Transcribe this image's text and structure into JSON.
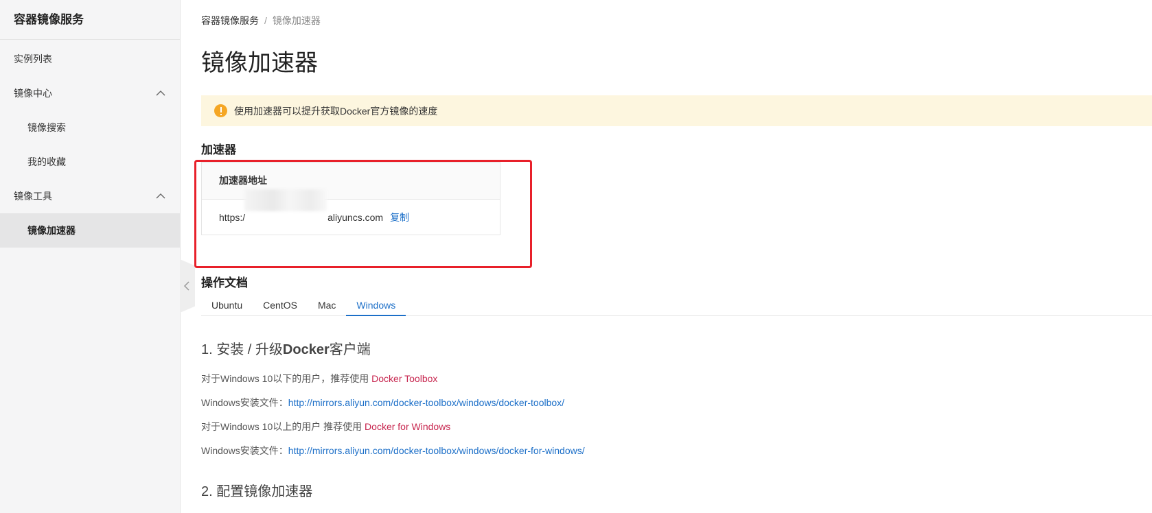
{
  "sidebar": {
    "title": "容器镜像服务",
    "items": [
      {
        "label": "实例列表"
      },
      {
        "label": "镜像中心"
      },
      {
        "label": "镜像搜索"
      },
      {
        "label": "我的收藏"
      },
      {
        "label": "镜像工具"
      },
      {
        "label": "镜像加速器"
      }
    ]
  },
  "breadcrumb": {
    "root": "容器镜像服务",
    "separator": "/",
    "current": "镜像加速器"
  },
  "page_title": "镜像加速器",
  "alert": {
    "text": "使用加速器可以提升获取Docker官方镜像的速度",
    "color": "#fdf6df"
  },
  "accelerator": {
    "section_title": "加速器",
    "column_header": "加速器地址",
    "url_prefix": "https:/",
    "url_suffix": "aliyuncs.com",
    "copy_label": "复制",
    "highlight_color": "#e8202a"
  },
  "docs": {
    "section_title": "操作文档",
    "tabs": [
      {
        "label": "Ubuntu"
      },
      {
        "label": "CentOS"
      },
      {
        "label": "Mac"
      },
      {
        "label": "Windows",
        "active": true
      }
    ],
    "step1": {
      "number": "1. ",
      "text_a": "安装 / 升级",
      "text_b": "Docker",
      "text_c": "客户端"
    },
    "lines": [
      {
        "text": "对于Windows 10以下的用户，推荐使用 ",
        "link": "Docker Toolbox"
      },
      {
        "text": "Windows安装文件：",
        "link": "http://mirrors.aliyun.com/docker-toolbox/windows/docker-toolbox/"
      },
      {
        "text": "对于Windows 10以上的用户 推荐使用 ",
        "link": "Docker for Windows"
      },
      {
        "text": "Windows安装文件：",
        "link": "http://mirrors.aliyun.com/docker-toolbox/windows/docker-for-windows/"
      }
    ],
    "step2": {
      "number": "2. ",
      "text": "配置镜像加速器"
    }
  },
  "colors": {
    "link_blue": "#1c6fc8",
    "link_red": "#c7254e"
  }
}
